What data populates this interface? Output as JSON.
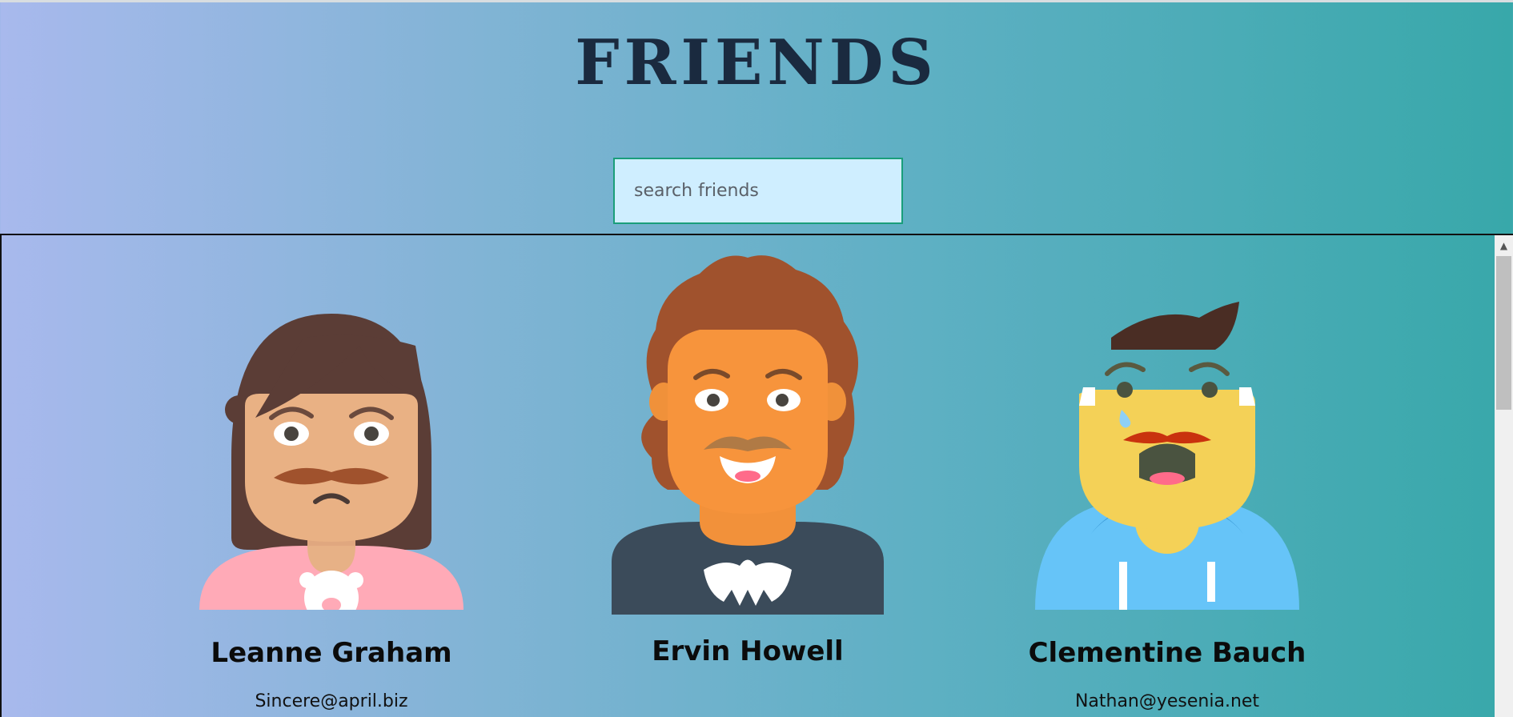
{
  "header": {
    "title": "FRIENDS"
  },
  "search": {
    "placeholder": "search friends"
  },
  "friends": [
    {
      "name": "Leanne Graham",
      "email": "Sincere@april.biz"
    },
    {
      "name": "Ervin Howell",
      "email": ""
    },
    {
      "name": "Clementine Bauch",
      "email": "Nathan@yesenia.net"
    }
  ],
  "colors": {
    "title": "#1a2a3f",
    "search_bg": "#cfeeff",
    "search_border": "#1a9e7a",
    "gradient_start": "#a8b9ed",
    "gradient_end": "#38a8aa"
  },
  "icons": [
    "avatar-woman-worried",
    "avatar-man-curly-hair",
    "avatar-man-crying",
    "scroll-up-arrow"
  ]
}
